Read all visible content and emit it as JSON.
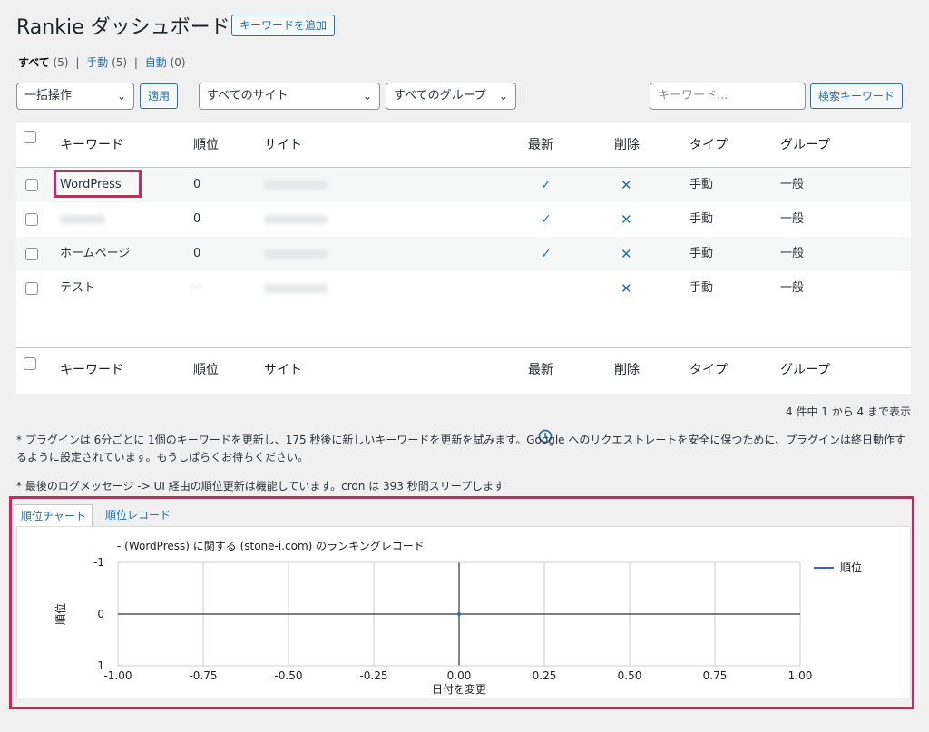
{
  "header": {
    "title": "Rankie ダッシュボード",
    "add_keyword_label": "キーワードを追加"
  },
  "filters": {
    "all_label": "すべて",
    "all_count": "(5)",
    "manual_label": "手動",
    "manual_count": "(5)",
    "auto_label": "自動",
    "auto_count": "(0)",
    "separator": "|"
  },
  "toolbar": {
    "bulk_action": "一括操作",
    "apply_label": "適用",
    "site_filter": "すべてのサイト",
    "group_filter": "すべてのグループ",
    "search_placeholder": "キーワード...",
    "search_label": "検索キーワード"
  },
  "table": {
    "columns": [
      "キーワード",
      "順位",
      "サイト",
      "最新",
      "削除",
      "タイプ",
      "グループ"
    ],
    "rows": [
      {
        "keyword": "WordPress",
        "rank": "0",
        "type": "手動",
        "group": "一般",
        "status": "check"
      },
      {
        "keyword": "",
        "rank": "0",
        "type": "手動",
        "group": "一般",
        "status": "check"
      },
      {
        "keyword": "ホームページ",
        "rank": "0",
        "type": "手動",
        "group": "一般",
        "status": "check"
      },
      {
        "keyword": "テスト",
        "rank": "-",
        "type": "手動",
        "group": "一般",
        "status": "clock"
      }
    ],
    "pagination": "4 件中 1 から 4 まで表示"
  },
  "notes": {
    "line1": "* プラグインは 6分ごとに 1個のキーワードを更新し、175 秒後に新しいキーワードを更新を試みます。Google へのリクエストレートを安全に保つために、プラグインは終日動作するように設定されています。もうしばらくお待ちください。",
    "line2": "* 最後のログメッセージ -> UI 経由の順位更新は機能しています。cron は 393 秒間スリープします"
  },
  "tabs": {
    "chart": "順位チャート",
    "records": "順位レコード"
  },
  "chart_data": {
    "type": "line",
    "title": "- (WordPress) に関する (stone-i.com) のランキングレコード",
    "xlabel": "日付を変更",
    "ylabel": "順位",
    "series": [
      {
        "name": "順位",
        "x": [
          0.0
        ],
        "y": [
          0
        ]
      }
    ],
    "xlim": [
      -1.0,
      1.0
    ],
    "ylim": [
      -1,
      1
    ],
    "y_inverted": true,
    "xticks": [
      "-1.00",
      "-0.75",
      "-0.50",
      "-0.25",
      "0.00",
      "0.25",
      "0.50",
      "0.75",
      "1.00"
    ],
    "yticks": [
      "-1",
      "0",
      "1"
    ],
    "grid": true,
    "legend": "right",
    "series_color": "#3366cc"
  }
}
